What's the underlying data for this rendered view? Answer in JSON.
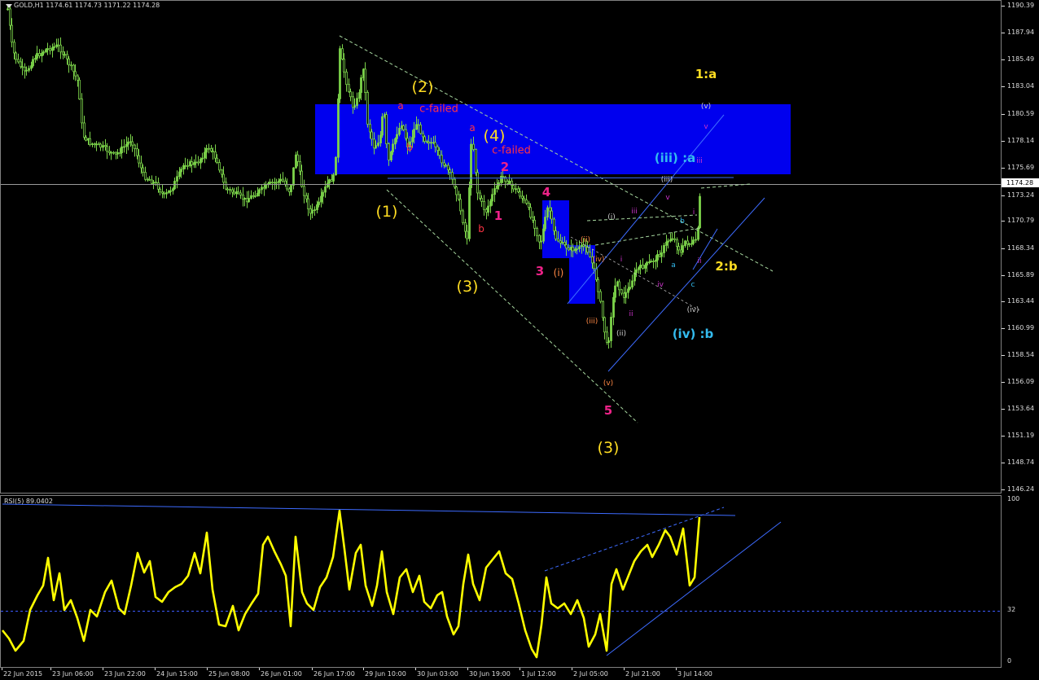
{
  "window": {
    "symbol_label": "GOLD,H1  1174.61 1174.73 1171.22 1174.28",
    "menu_icon": "triangle-down-icon"
  },
  "price_axis": {
    "labels": [
      "1190.39",
      "1187.94",
      "1185.49",
      "1183.04",
      "1180.59",
      "1178.14",
      "1175.69",
      "1173.24",
      "1170.79",
      "1168.34",
      "1165.89",
      "1163.44",
      "1160.99",
      "1158.54",
      "1156.09",
      "1153.64",
      "1151.19",
      "1148.74",
      "1146.24"
    ],
    "current_price": "1174.28"
  },
  "rsi": {
    "title": "RSI(5) 89.0402",
    "levels": [
      "100",
      "32",
      "0"
    ],
    "level_line": 32
  },
  "time_axis": {
    "labels": [
      "22 Jun 2015",
      "23 Jun 06:00",
      "23 Jun 22:00",
      "24 Jun 15:00",
      "25 Jun 08:00",
      "26 Jun 01:00",
      "26 Jun 17:00",
      "29 Jun 10:00",
      "30 Jun 03:00",
      "30 Jun 19:00",
      "1 Jul 12:00",
      "2 Jul 05:00",
      "2 Jul 21:00",
      "3 Jul 14:00"
    ]
  },
  "colors": {
    "background": "#000000",
    "candle": "#7cd44a",
    "zone": "#0000ee",
    "rsi_line": "#ffff00",
    "trendline": "#3d5bff",
    "dashed_line": "#a8d8a0",
    "yellow_label": "#ffdd22",
    "magenta_label": "#ee2288",
    "orange_label": "#ff8844",
    "cyan_label": "#33bbee",
    "red_label": "#ff3344"
  },
  "wave_labels": [
    {
      "text": "(2)",
      "color": "yellow",
      "size": "big"
    },
    {
      "text": "a",
      "color": "red",
      "size": "small"
    },
    {
      "text": "c-failed",
      "color": "red",
      "size": "mid"
    },
    {
      "text": "b",
      "color": "red",
      "size": "small"
    },
    {
      "text": "a",
      "color": "red",
      "size": "small"
    },
    {
      "text": "(4)",
      "color": "yellow",
      "size": "big"
    },
    {
      "text": "c-failed",
      "color": "red",
      "size": "mid"
    },
    {
      "text": "2",
      "color": "magenta",
      "size": "bold"
    },
    {
      "text": "4",
      "color": "magenta",
      "size": "bold"
    },
    {
      "text": "1",
      "color": "magenta",
      "size": "bold"
    },
    {
      "text": "b",
      "color": "red",
      "size": "small"
    },
    {
      "text": "(1)",
      "color": "yellow",
      "size": "big"
    },
    {
      "text": "(3)",
      "color": "yellow",
      "size": "big"
    },
    {
      "text": "3",
      "color": "magenta",
      "size": "bold"
    },
    {
      "text": "(i)",
      "color": "orange",
      "size": "small"
    },
    {
      "text": "(ii)",
      "color": "orange",
      "size": "tiny"
    },
    {
      "text": "(iv)",
      "color": "orange",
      "size": "tiny"
    },
    {
      "text": "(iii)",
      "color": "orange",
      "size": "tiny"
    },
    {
      "text": "(v)",
      "color": "orange",
      "size": "tiny"
    },
    {
      "text": "5",
      "color": "magenta",
      "size": "bold"
    },
    {
      "text": "(3)",
      "color": "yellow",
      "size": "big"
    },
    {
      "text": "1:a",
      "color": "yellow",
      "size": "bold"
    },
    {
      "text": "(v)",
      "color": "grey",
      "size": "tiny"
    },
    {
      "text": "v",
      "color": "violet",
      "size": "tiny"
    },
    {
      "text": "(iii) :a",
      "color": "cyan",
      "size": "bold"
    },
    {
      "text": "iii",
      "color": "violet",
      "size": "tiny"
    },
    {
      "text": "(iii)",
      "color": "grey",
      "size": "tiny"
    },
    {
      "text": "v",
      "color": "violet",
      "size": "tiny"
    },
    {
      "text": "iii",
      "color": "violet",
      "size": "tiny"
    },
    {
      "text": "(i)",
      "color": "grey",
      "size": "tiny"
    },
    {
      "text": "i",
      "color": "violet",
      "size": "tiny"
    },
    {
      "text": "b",
      "color": "cyan",
      "size": "tiny"
    },
    {
      "text": "i",
      "color": "violet",
      "size": "tiny"
    },
    {
      "text": "a",
      "color": "cyan",
      "size": "tiny"
    },
    {
      "text": "ii",
      "color": "violet",
      "size": "tiny"
    },
    {
      "text": "2:b",
      "color": "yellow",
      "size": "bold"
    },
    {
      "text": "iv",
      "color": "violet",
      "size": "tiny"
    },
    {
      "text": "c",
      "color": "cyan",
      "size": "tiny"
    },
    {
      "text": "ii",
      "color": "violet",
      "size": "tiny"
    },
    {
      "text": "(iv)",
      "color": "grey",
      "size": "tiny"
    },
    {
      "text": "(ii)",
      "color": "grey",
      "size": "tiny"
    },
    {
      "text": "(iv) :b",
      "color": "cyan",
      "size": "bold"
    }
  ]
}
